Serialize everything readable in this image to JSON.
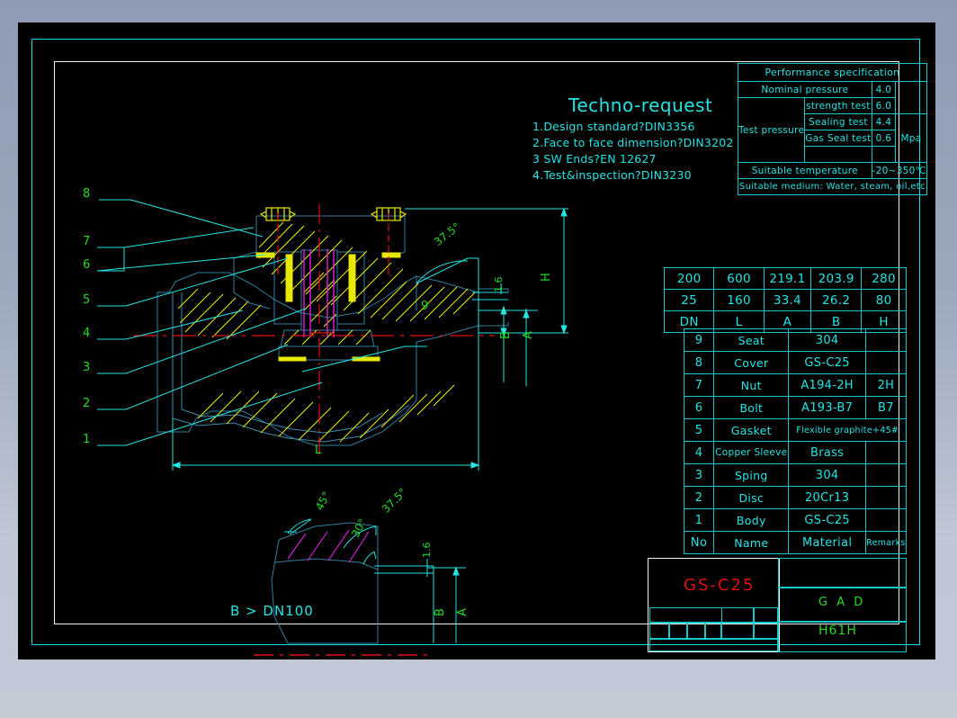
{
  "sheet": {
    "border_color_outer": "#00e5e5",
    "border_color_inner": "#f2f2f2",
    "background": "#000000"
  },
  "notes": {
    "title": "Techno-request",
    "lines": [
      "1.Design standard?DIN3356",
      "2.Face to face dimension?DIN3202",
      "3 SW Ends?EN 12627",
      "4.Test&inspection?DIN3230"
    ]
  },
  "performance_table": {
    "title": "Performance specification",
    "rows": [
      {
        "label": "Nominal pressure",
        "sub": "",
        "value": "4.0",
        "unit": ""
      },
      {
        "label": "Test pressure",
        "sub": "strength test",
        "value": "6.0",
        "unit": "Mpa"
      },
      {
        "label": "",
        "sub": "Sealing test",
        "value": "4.4",
        "unit": ""
      },
      {
        "label": "",
        "sub": "Gas Seal test",
        "value": "0.6",
        "unit": ""
      },
      {
        "label": "",
        "sub": "",
        "value": "",
        "unit": ""
      }
    ],
    "temperature_label": "Suitable temperature",
    "temperature_value": "-20~350℃",
    "medium": "Suitable medium: Water, steam, oil,etc"
  },
  "dimension_table": {
    "rows": [
      [
        "200",
        "600",
        "219.1",
        "203.9",
        "280"
      ],
      [
        "25",
        "160",
        "33.4",
        "26.2",
        "80"
      ],
      [
        "DN",
        "L",
        "A",
        "B",
        "H"
      ]
    ]
  },
  "parts_list": {
    "header": [
      "No",
      "Name",
      "Material",
      "Remarks"
    ],
    "rows": [
      [
        "9",
        "Seat",
        "304",
        ""
      ],
      [
        "8",
        "Cover",
        "GS-C25",
        ""
      ],
      [
        "7",
        "Nut",
        "A194-2H",
        "2H"
      ],
      [
        "6",
        "Bolt",
        "A193-B7",
        "B7"
      ],
      [
        "5",
        "Gasket",
        "Flexible graphite+45#",
        ""
      ],
      [
        "4",
        "Copper Sleeve",
        "Brass",
        ""
      ],
      [
        "3",
        "Sping",
        "304",
        ""
      ],
      [
        "2",
        "Disc",
        "20Cr13",
        ""
      ],
      [
        "1",
        "Body",
        "GS-C25",
        ""
      ]
    ]
  },
  "title_block": {
    "material": "GS-C25",
    "material_color": "#e01010",
    "drawing_label": "G A D",
    "model": "H61H",
    "text_color": "#20dd20"
  },
  "main_view": {
    "leader_numbers": [
      "1",
      "2",
      "3",
      "4",
      "5",
      "6",
      "7",
      "8",
      "9"
    ],
    "dimension_labels": [
      "L",
      "H",
      "A",
      "B",
      "1.6"
    ],
    "angle_labels": [
      "37.5°"
    ]
  },
  "detail_view": {
    "caption": "B > DN100",
    "angle_labels": [
      "45°",
      "37.5°",
      "30°"
    ],
    "dimension_labels": [
      "1.6",
      "A",
      "B"
    ]
  },
  "colors": {
    "line_cyan": "#24e4e4",
    "line_blue": "#2f7f9f",
    "hatch_yellow": "#e8e800",
    "hatch_magenta": "#e020e0",
    "centerline_red": "#e01010",
    "text_green": "#20dd20"
  }
}
